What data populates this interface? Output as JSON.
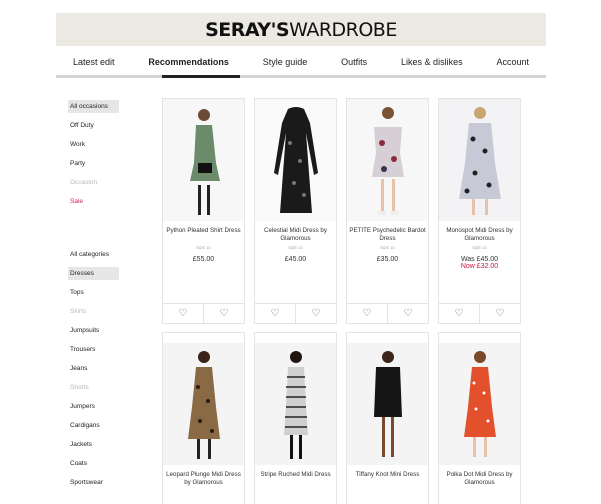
{
  "brand": {
    "bold": "SERAY'S",
    "light": "WARDROBE"
  },
  "nav": {
    "tabs": [
      "Latest edit",
      "Recommendations",
      "Style guide",
      "Outfits",
      "Likes & dislikes",
      "Account"
    ],
    "active": "Recommendations"
  },
  "sidebar": {
    "occasions": [
      "All occasions",
      "Off Duty",
      "Work",
      "Party",
      "Occasion",
      "Sale"
    ],
    "categories": [
      "All categories",
      "Dresses",
      "Tops",
      "Skirts",
      "Jumpsuits",
      "Trousers",
      "Jeans",
      "Shorts",
      "Jumpers",
      "Cardigans",
      "Jackets",
      "Coats",
      "Sportswear"
    ]
  },
  "products": [
    {
      "name": "Python Pleated Shirt Dress",
      "size": "SIZE 10",
      "price": "£55.00"
    },
    {
      "name": "Celestial Midi Dress by Glamorous",
      "size": "SIZE 10",
      "price": "£45.00"
    },
    {
      "name": "PETITE Psychedelic Bardot Dress",
      "size": "SIZE 10",
      "price": "£35.00"
    },
    {
      "name": "Monospot Midi Dress by Glamorous",
      "size": "SIZE 10",
      "was": "Was £45.00",
      "now": "Now £32.00"
    },
    {
      "name": "Leopard Plunge Midi Dress by Glamorous"
    },
    {
      "name": "Stripe Ruched Midi Dress"
    },
    {
      "name": "Tiffany Knot Mini Dress"
    },
    {
      "name": "Polka Dot Midi Dress by Glamorous"
    }
  ],
  "colors": {
    "sale": "#d0246a",
    "now_price": "#c4163f",
    "banner": "#ece9e3"
  },
  "icons": {
    "like": "heart-icon",
    "dislike": "broken-heart-icon"
  }
}
